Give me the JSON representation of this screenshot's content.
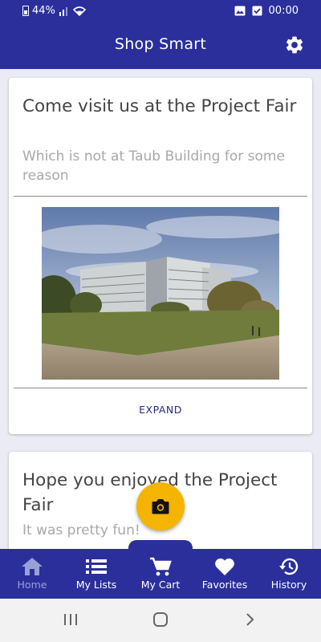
{
  "status_bar": {
    "battery": "44%",
    "time": "00:00"
  },
  "app_bar": {
    "title": "Shop Smart",
    "settings_icon": "gear-icon"
  },
  "cards": [
    {
      "title": "Come visit us at the Project Fair",
      "subtitle": "Which is not at Taub Building for some reason",
      "image": "building-photo",
      "action": "EXPAND"
    },
    {
      "title": "Hope you enjoyed the Project Fair",
      "subtitle": "It was pretty fun!"
    }
  ],
  "fab": {
    "icon": "camera-icon"
  },
  "bottom_nav": {
    "items": [
      {
        "label": "Home",
        "icon": "home-icon",
        "active": true
      },
      {
        "label": "My Lists",
        "icon": "list-icon",
        "active": false
      },
      {
        "label": "My Cart",
        "icon": "cart-icon",
        "active": false
      },
      {
        "label": "Favorites",
        "icon": "heart-icon",
        "active": false
      },
      {
        "label": "History",
        "icon": "history-icon",
        "active": false
      }
    ]
  },
  "colors": {
    "primary": "#2a2f9c",
    "accent": "#f4b400",
    "background": "#ebebf6"
  }
}
